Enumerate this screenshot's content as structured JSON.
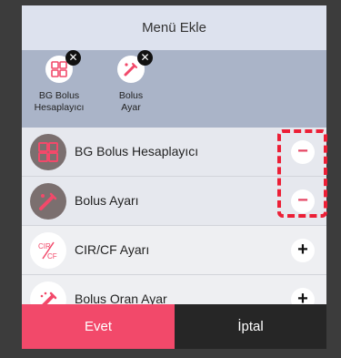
{
  "header": {
    "title": "Menü Ekle"
  },
  "selected_items": [
    {
      "label_line1": "BG Bolus",
      "label_line2": "Hesaplayıcı",
      "icon": "bg-bolus-calculator-icon",
      "remove_glyph": "✕"
    },
    {
      "label_line1": "Bolus",
      "label_line2": "Ayar",
      "icon": "bolus-settings-icon",
      "remove_glyph": "✕"
    }
  ],
  "menu_items": [
    {
      "label": "BG Bolus Hesaplayıcı",
      "icon": "bg-bolus-calculator-icon",
      "action": "−",
      "state": "added"
    },
    {
      "label": "Bolus Ayarı",
      "icon": "bolus-settings-icon",
      "action": "−",
      "state": "added"
    },
    {
      "label": "CIR/CF Ayarı",
      "icon": "cir-cf-icon",
      "icon_text_top": "CIR",
      "icon_text_bottom": "CF",
      "action": "+",
      "state": "available"
    },
    {
      "label": "Bolus Oran Ayar",
      "icon": "bolus-rate-icon",
      "action": "+",
      "state": "available"
    }
  ],
  "footer": {
    "confirm_label": "Evet",
    "cancel_label": "İptal"
  },
  "colors": {
    "accent": "#f2496a",
    "header_bg": "#dde2ee",
    "selected_bg": "#aab4c8",
    "highlight": "#ec1f36"
  }
}
